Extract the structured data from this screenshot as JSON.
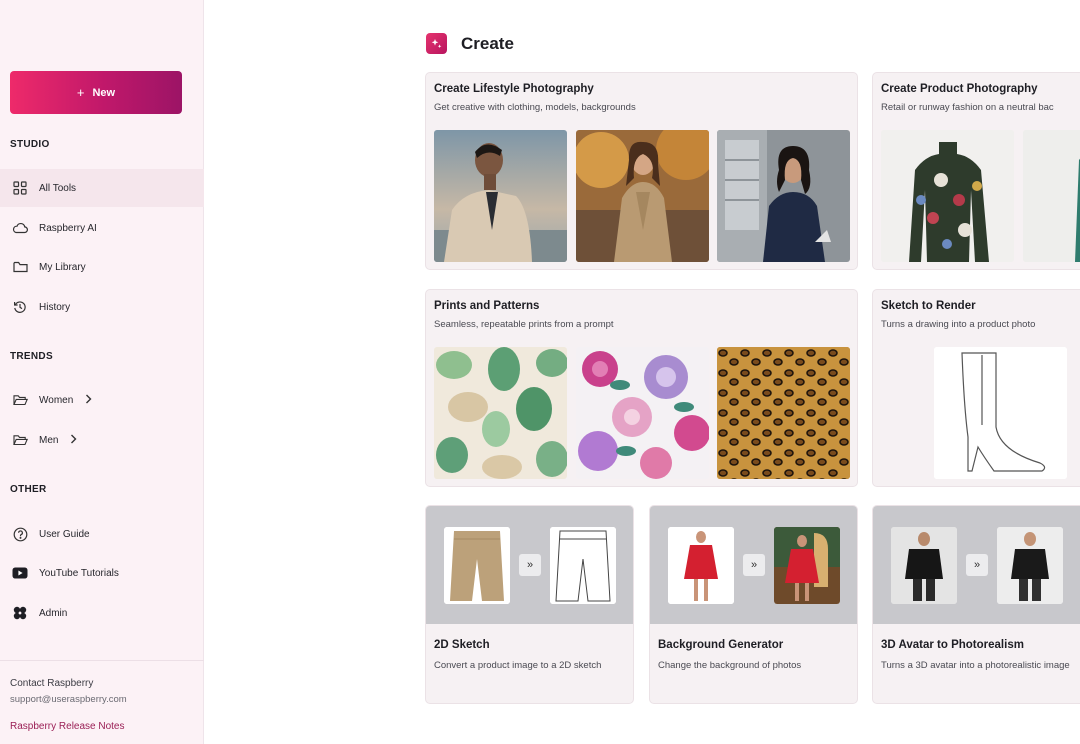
{
  "sidebar": {
    "new_label": "New",
    "sections": {
      "studio": "STUDIO",
      "trends": "TRENDS",
      "other": "OTHER"
    },
    "studio_items": [
      {
        "label": "All Tools",
        "icon": "grid-icon"
      },
      {
        "label": "Raspberry AI",
        "icon": "cloud-icon"
      },
      {
        "label": "My Library",
        "icon": "folder-icon"
      },
      {
        "label": "History",
        "icon": "history-icon"
      }
    ],
    "trends_items": [
      {
        "label": "Women",
        "icon": "folder-open-icon"
      },
      {
        "label": "Men",
        "icon": "folder-open-icon"
      }
    ],
    "other_items": [
      {
        "label": "User Guide",
        "icon": "help-circle-icon"
      },
      {
        "label": "YouTube Tutorials",
        "icon": "youtube-icon"
      },
      {
        "label": "Admin",
        "icon": "admin-flower-icon"
      }
    ],
    "footer": {
      "contact": "Contact Raspberry",
      "email": "support@useraspberry.com",
      "release_notes": "Raspberry Release Notes"
    }
  },
  "main": {
    "title": "Create",
    "cards": [
      {
        "title": "Create Lifestyle Photography",
        "subtitle": "Get creative with clothing, models, backgrounds"
      },
      {
        "title": "Create Product Photography",
        "subtitle": "Retail or runway fashion on a neutral bac"
      },
      {
        "title": "Prints and Patterns",
        "subtitle": "Seamless, repeatable prints from a prompt"
      },
      {
        "title": "Sketch to Render",
        "subtitle": "Turns a drawing into a product photo"
      }
    ],
    "tools": [
      {
        "title": "2D Sketch",
        "description": "Convert a product image to a 2D sketch"
      },
      {
        "title": "Background Generator",
        "description": "Change the background of photos"
      },
      {
        "title": "3D Avatar to Photorealism",
        "description": "Turns a 3D avatar into a photorealistic image"
      }
    ],
    "arrow_glyph": "»"
  },
  "colors": {
    "accent": "#d31d66",
    "sidebar_bg": "#fcf2f6",
    "card_bg": "#f6f1f3"
  }
}
